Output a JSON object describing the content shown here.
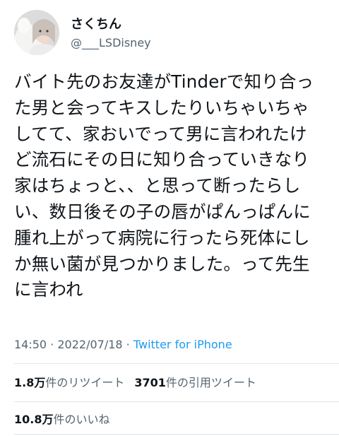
{
  "user": {
    "display_name": "さくちん",
    "handle": "@___LSDisney"
  },
  "tweet": {
    "text": "バイト先のお友達がTinderで知り合っ\nた男と会ってキスしたりいちゃいちゃ\nしてて、家おいでって男に言われたけ\nど流石にその日に知り合っていきなり\n家はちょっと、、と思って断ったらし\nい、数日後その子の唇がぱんっぱんに\n腫れ上がって病院に行ったら死体にし\nか無い菌が見つかりました。って先生\nに言われ"
  },
  "meta": {
    "time": "14:50",
    "separator": " · ",
    "date": "2022/07/18",
    "source": "Twitter for iPhone"
  },
  "stats": {
    "retweets_count": "1.8万",
    "retweets_label": "件のリツイート",
    "quotes_count": "3701",
    "quotes_label": "件の引用ツイート",
    "likes_count": "10.8万",
    "likes_label": "件のいいね"
  }
}
